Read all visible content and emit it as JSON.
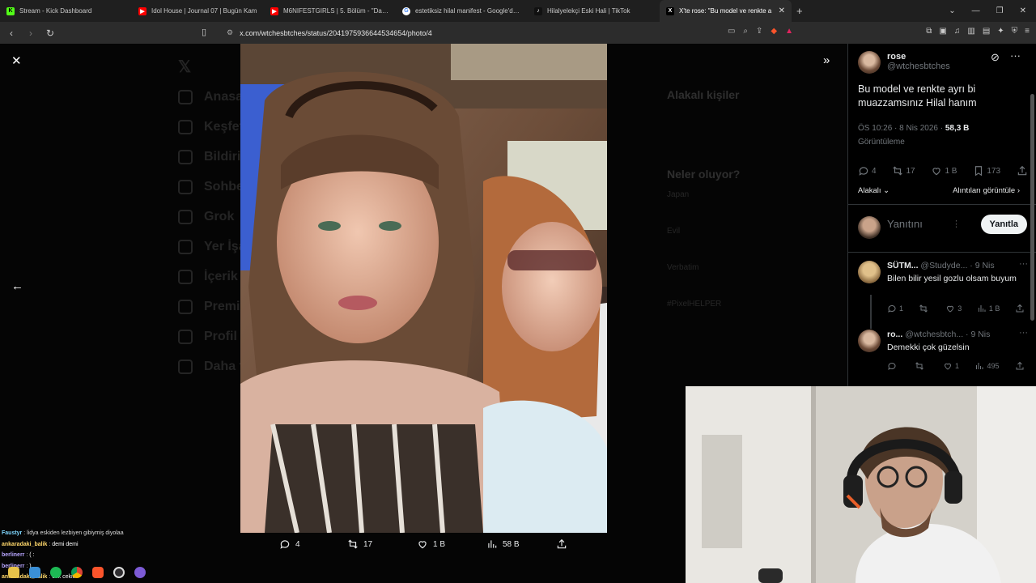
{
  "browser": {
    "tabs": [
      {
        "title": "Stream - Kick Dashboard",
        "favicon_color": "#53fc18",
        "favicon_glyph": "K"
      },
      {
        "title": "Idol House | Journal 07 | Bugün Kam",
        "favicon_color": "#ff0000",
        "favicon_glyph": "▶"
      },
      {
        "title": "M6NIFESTGIRLS | 5. Bölüm - \"Daha İy",
        "favicon_color": "#ff0000",
        "favicon_glyph": "▶"
      },
      {
        "title": "estetiksiz hilal manifest - Google'da A",
        "favicon_color": "#4285f4",
        "favicon_glyph": "G"
      },
      {
        "title": "Hilalyelekçi Eski Hali | TikTok",
        "favicon_color": "#111111",
        "favicon_glyph": "♪"
      },
      {
        "title": "X'te rose: \"Bu model ve renkte a",
        "favicon_color": "#000000",
        "favicon_glyph": "X",
        "active": true
      }
    ],
    "url": "x.com/wtchesbtches/status/2041975936644534654/photo/4"
  },
  "ghost_nav": [
    "Anasayfa",
    "Keşfet",
    "Bildirimler",
    "Sohbet",
    "Grok",
    "Yer İşaretleri",
    "İçerik",
    "Premium",
    "Profil",
    "Daha fazla"
  ],
  "ghost_right": {
    "section1": "Alakalı kişiler",
    "section2": "Neler oluyor?",
    "trends": [
      "Japan",
      "Evil",
      "Verbatim",
      "#PixelHELPER"
    ]
  },
  "photo_actions": {
    "replies": "4",
    "reposts": "17",
    "likes": "1 B",
    "views": "58 B"
  },
  "chat": [
    {
      "user": "Faustyr",
      "msg": "lidya eskiden lezbiyen gibiymiş diyolaa",
      "color": "#7fd7ff"
    },
    {
      "user": "ankaradaki_balik",
      "msg": "demi demi",
      "color": "#ffd86b"
    },
    {
      "user": "berlinerr",
      "msg": "( :",
      "color": "#b8a6ff"
    },
    {
      "user": "berlinerr",
      "msg": ")",
      "color": "#b8a6ff"
    },
    {
      "user": "ankaradaki_balik",
      "msg": "cok cekici",
      "color": "#ffd86b"
    }
  ],
  "tweet": {
    "name": "rose",
    "handle": "@wtchesbtches",
    "text": "Bu model ve renkte ayrı bi muazzamsınız Hilal hanım",
    "time": "ÖS 10:26 · 8 Nis 2026 ·",
    "views": "58,3 B",
    "views_label": "Görüntüleme",
    "stats": {
      "replies": "4",
      "reposts": "17",
      "likes": "1 B",
      "bookmarks": "173"
    },
    "sort_label": "Alakalı",
    "quotes_label": "Alıntıları görüntüle"
  },
  "reply_box": {
    "placeholder": "Yanıtını",
    "button": "Yanıtla"
  },
  "replies": [
    {
      "name": "SÜTM...",
      "handle": "@Studyde...",
      "date": "· 9 Nis",
      "text": "Bilen bilir yesil gozlu olsam buyum",
      "replies": "1",
      "reposts": "",
      "likes": "3",
      "views": "1 B"
    },
    {
      "name": "ro...",
      "handle": "@wtchesbtch...",
      "date": "· 9 Nis",
      "text": "Demekki çok güzelsin",
      "replies": "",
      "reposts": "",
      "likes": "1",
      "views": "495"
    }
  ]
}
